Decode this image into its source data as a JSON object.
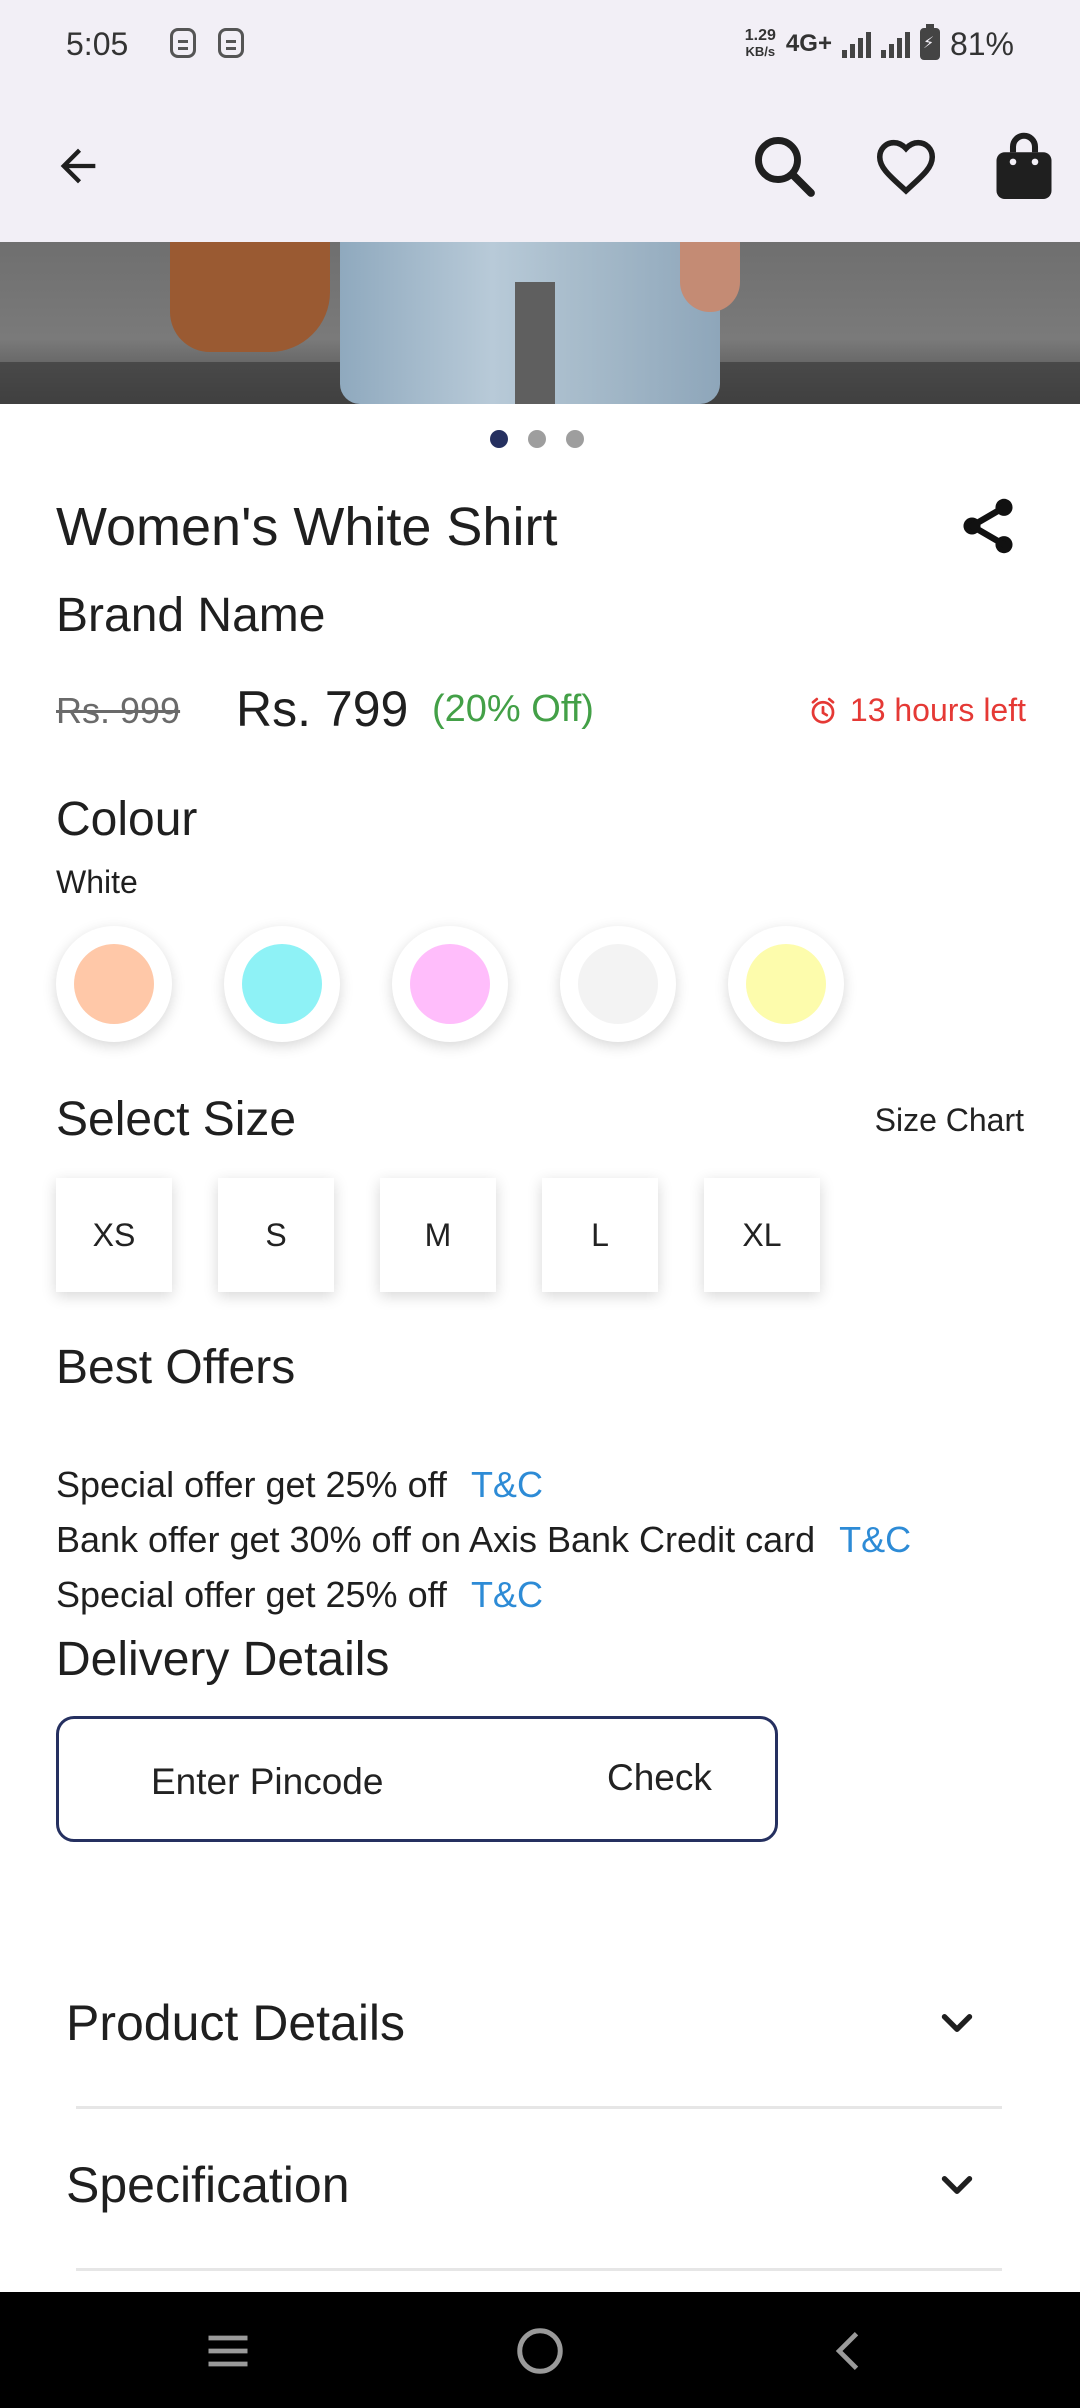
{
  "status_bar": {
    "time": "5:05",
    "net_speed_value": "1.29",
    "net_speed_unit": "KB/s",
    "network": "4G+",
    "battery": "81%"
  },
  "app_bar": {
    "icons": [
      "back-arrow-icon",
      "search-icon",
      "heart-icon",
      "shopping-bag-icon"
    ]
  },
  "carousel": {
    "count": 3,
    "active_index": 0
  },
  "product": {
    "title": "Women's White Shirt",
    "brand": "Brand Name",
    "old_price": "Rs. 999",
    "price": "Rs. 799",
    "discount": "(20% Off)",
    "timer": "13 hours left"
  },
  "colour": {
    "heading": "Colour",
    "selected": "White",
    "swatches": [
      "#ffc8a8",
      "#8ef2f6",
      "#ffbdfb",
      "#f3f3f3",
      "#fdfcac"
    ]
  },
  "size": {
    "heading": "Select Size",
    "chart_label": "Size Chart",
    "options": [
      "XS",
      "S",
      "M",
      "L",
      "XL"
    ]
  },
  "offers": {
    "heading": "Best Offers",
    "items": [
      {
        "text": "Special offer get 25% off",
        "link": "T&C"
      },
      {
        "text": "Bank offer get 30% off on Axis Bank Credit card",
        "link": "T&C"
      },
      {
        "text": "Special offer get 25% off",
        "link": "T&C"
      }
    ]
  },
  "delivery": {
    "heading": "Delivery Details",
    "placeholder": "Enter Pincode",
    "check_label": "Check"
  },
  "sections": [
    {
      "label": "Product Details"
    },
    {
      "label": "Specification"
    }
  ],
  "colors": {
    "accent_navy": "#253060",
    "discount_green": "#43a047",
    "timer_red": "#e53935",
    "link_blue": "#2d8bd6",
    "app_bar_bg": "#f2eff6"
  }
}
